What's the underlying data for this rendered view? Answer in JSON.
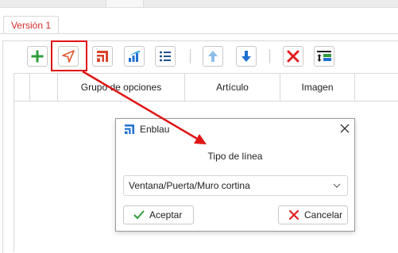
{
  "version_tab": {
    "label": "Versión 1"
  },
  "grid": {
    "columns": [
      "",
      "",
      "Grupo de opciones",
      "Artículo",
      "Imagen",
      ""
    ]
  },
  "toolbar": {
    "buttons": [
      "add-icon",
      "pointer-arrow-icon",
      "stair-profile-icon",
      "bar-chart-icon",
      "list-icon",
      "move-up-icon",
      "move-down-icon",
      "delete-icon",
      "settings-sort-icon"
    ]
  },
  "dialog": {
    "title": "Enblau",
    "label": "Tipo de línea",
    "select": {
      "value": "Ventana/Puerta/Muro cortina"
    },
    "accept_label": "Aceptar",
    "cancel_label": "Cancelar"
  },
  "colors": {
    "accent_red": "#e01515",
    "add_green": "#2e9d3a",
    "arrow_blue": "#1f6fd1",
    "light_blue": "#8bbde8"
  }
}
